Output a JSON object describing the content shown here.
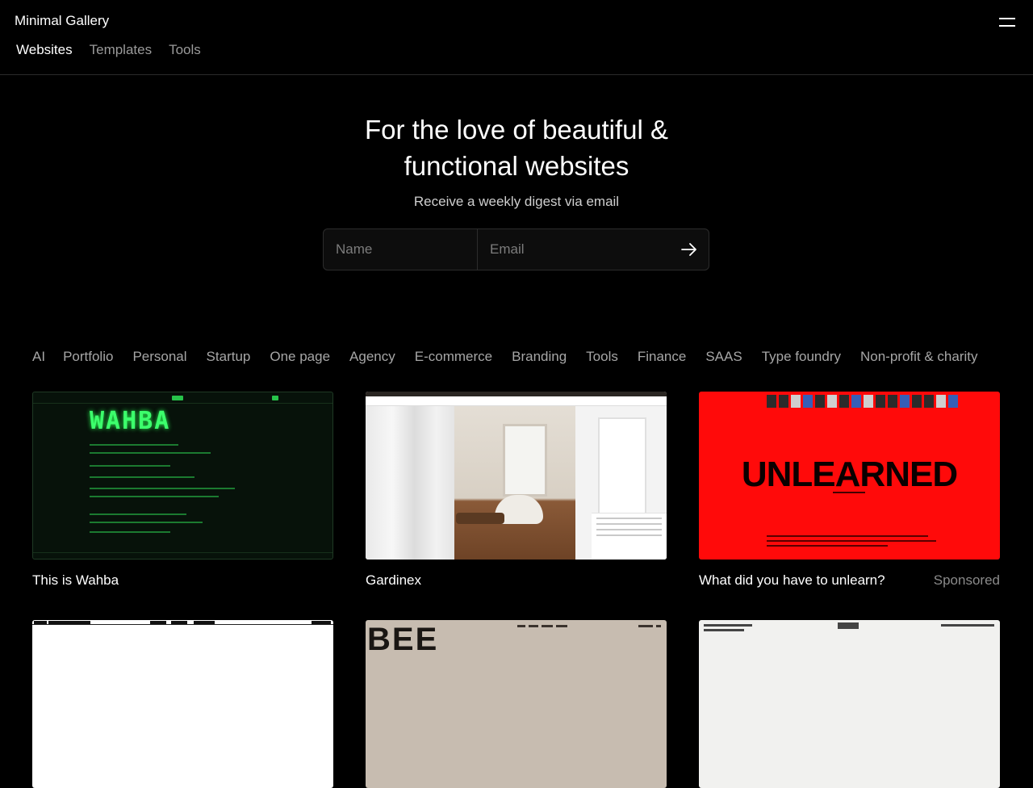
{
  "header": {
    "brand": "Minimal Gallery",
    "nav": [
      {
        "label": "Websites",
        "active": true
      },
      {
        "label": "Templates",
        "active": false
      },
      {
        "label": "Tools",
        "active": false
      }
    ],
    "menu_icon": "hamburger-menu-icon"
  },
  "hero": {
    "title_line1": "For the love of beautiful &",
    "title_line2": "functional websites",
    "subtitle": "Receive a weekly digest via email",
    "name_placeholder": "Name",
    "email_placeholder": "Email",
    "submit_icon": "arrow-right-icon"
  },
  "categories": [
    "AI",
    "Portfolio",
    "Personal",
    "Startup",
    "One page",
    "Agency",
    "E-commerce",
    "Branding",
    "Tools",
    "Finance",
    "SAAS",
    "Type foundry",
    "Non-profit & charity"
  ],
  "cards": [
    {
      "title": "This is Wahba",
      "tag": "",
      "thumb_text": "WAHBA"
    },
    {
      "title": "Gardinex",
      "tag": ""
    },
    {
      "title": "What did you have to unlearn?",
      "tag": "Sponsored",
      "thumb_text": "UNLEARNED"
    }
  ],
  "row2": [
    {
      "thumb_text": ""
    },
    {
      "thumb_text": "BEE"
    },
    {
      "thumb_text": ""
    }
  ],
  "colors": {
    "background": "#000000",
    "text": "#ffffff",
    "muted": "#a6a6a6",
    "accent_red": "#ff0a0a",
    "accent_green": "#3cff6c"
  }
}
